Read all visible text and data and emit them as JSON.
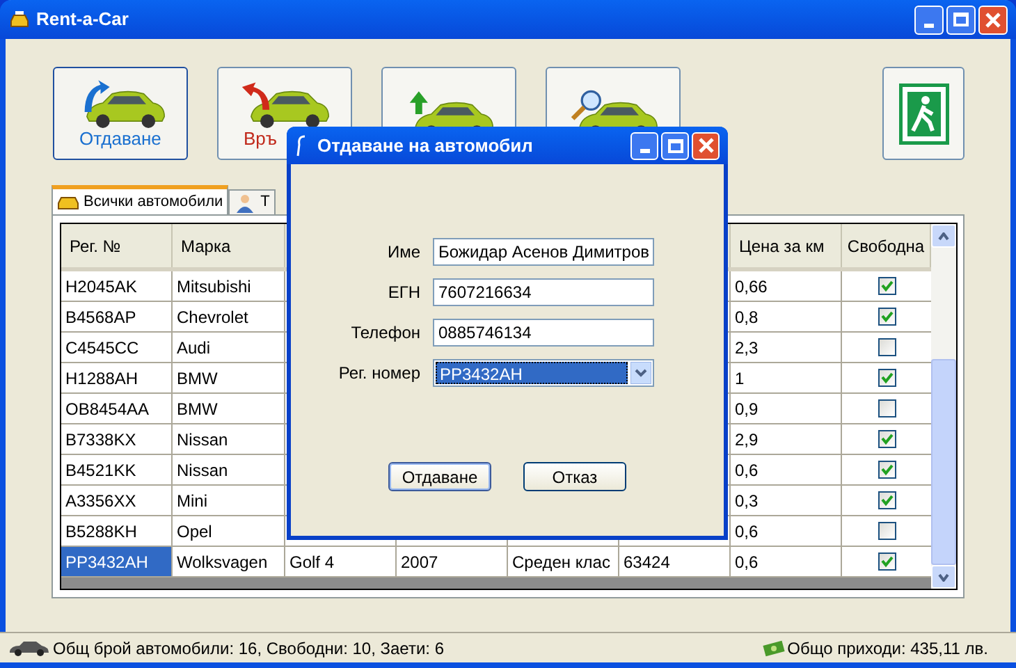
{
  "window": {
    "title": "Rent-a-Car"
  },
  "toolbar": [
    {
      "kind": "give",
      "label": "Отдаване"
    },
    {
      "kind": "return",
      "label": "Връ"
    },
    {
      "kind": "add"
    },
    {
      "kind": "search"
    },
    {
      "kind": "exit"
    }
  ],
  "tabs": [
    {
      "label": "Всички автомобили",
      "selected": true
    },
    {
      "label": "Т",
      "selected": false
    }
  ],
  "table": {
    "columns": [
      "Рег. №",
      "Марка",
      "Цена за км",
      "Свободна"
    ],
    "rows": [
      {
        "reg": "H2045AK",
        "brand": "Mitsubishi",
        "price": "0,66",
        "free": true,
        "selected": false
      },
      {
        "reg": "B4568AP",
        "brand": "Chevrolet",
        "price": "0,8",
        "free": true,
        "selected": false
      },
      {
        "reg": "C4545CC",
        "brand": "Audi",
        "price": "2,3",
        "free": false,
        "selected": false
      },
      {
        "reg": "H1288AH",
        "brand": "BMW",
        "price": "1",
        "free": true,
        "selected": false
      },
      {
        "reg": "OB8454AA",
        "brand": "BMW",
        "price": "0,9",
        "free": false,
        "selected": false
      },
      {
        "reg": "B7338KX",
        "brand": "Nissan",
        "price": "2,9",
        "free": true,
        "selected": false
      },
      {
        "reg": "B4521KK",
        "brand": "Nissan",
        "price": "0,6",
        "free": true,
        "selected": false
      },
      {
        "reg": "A3356XX",
        "brand": "Mini",
        "price": "0,3",
        "free": true,
        "selected": false
      },
      {
        "reg": "B5288KH",
        "brand": "Opel",
        "price": "0,6",
        "free": false,
        "selected": false
      },
      {
        "reg": "PP3432AH",
        "brand": "Wolksvagen",
        "model": "Golf 4",
        "year": "2007",
        "class": "Среден клас",
        "mileage": "63424",
        "price": "0,6",
        "free": true,
        "selected": true
      }
    ]
  },
  "dialog": {
    "title": "Отдаване на автомобил",
    "fields": [
      {
        "kind": "text",
        "label": "Име",
        "value": "Божидар Асенов Димитров"
      },
      {
        "kind": "text",
        "label": "ЕГН",
        "value": "7607216634"
      },
      {
        "kind": "text",
        "label": "Телефон",
        "value": "0885746134"
      },
      {
        "kind": "select",
        "label": "Рег. номер",
        "value": "PP3432AH"
      }
    ],
    "buttons": [
      "Отдаване",
      "Отказ"
    ]
  },
  "status_bar": {
    "left": "Общ брой автомобили: 16, Свободни: 10, Заети: 6",
    "right": "Общо приходи: 435,11 лв."
  }
}
